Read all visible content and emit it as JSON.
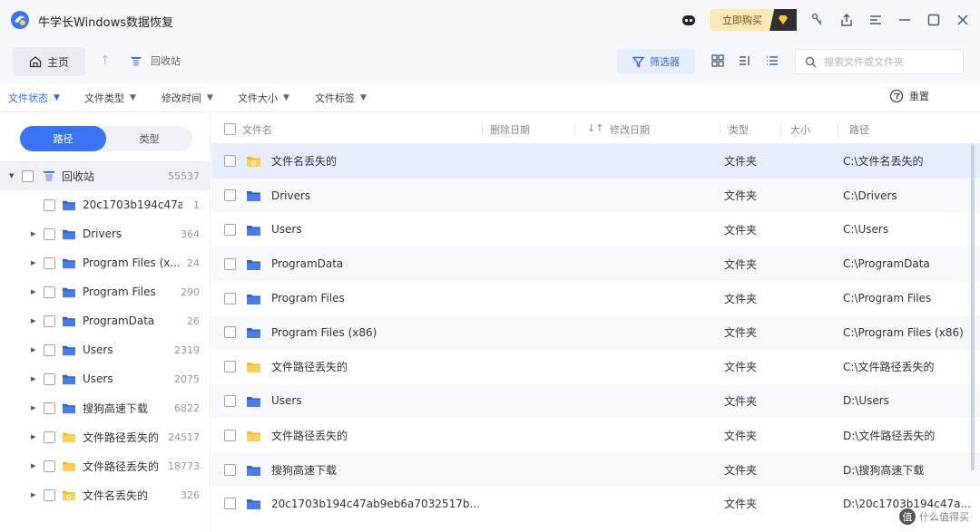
{
  "app": {
    "title": "牛学长Windows数据恢复",
    "buy_label": "立即购买",
    "colors": {
      "accent": "#3b74f2",
      "folder_blue": "#3f6fd8",
      "folder_yellow": "#f5b92b",
      "buy_bg": "#fde9b8"
    }
  },
  "toolbar": {
    "home_label": "主页",
    "crumb_label": "回收站",
    "filter_label": "筛选器",
    "search_placeholder": "搜索文件或文件夹"
  },
  "filters": {
    "file_status": "文件状态",
    "file_type": "文件类型",
    "modified_time": "修改时间",
    "file_size": "文件大小",
    "file_tag": "文件标签",
    "reset": "重置"
  },
  "sidebar": {
    "seg_path": "路径",
    "seg_type": "类型",
    "root": {
      "label": "回收站",
      "count": "55537"
    },
    "items": [
      {
        "label": "20c1703b194c47a...",
        "count": "1",
        "color": "blue",
        "expandable": false
      },
      {
        "label": "Drivers",
        "count": "364",
        "color": "blue",
        "expandable": true
      },
      {
        "label": "Program Files (x...",
        "count": "24",
        "color": "blue",
        "expandable": true
      },
      {
        "label": "Program Files",
        "count": "290",
        "color": "blue",
        "expandable": true
      },
      {
        "label": "ProgramData",
        "count": "26",
        "color": "blue",
        "expandable": true
      },
      {
        "label": "Users",
        "count": "2319",
        "color": "blue",
        "expandable": true
      },
      {
        "label": "Users",
        "count": "2075",
        "color": "blue",
        "expandable": true
      },
      {
        "label": "搜狗高速下载",
        "count": "6822",
        "color": "blue",
        "expandable": true
      },
      {
        "label": "文件路径丢失的",
        "count": "24517",
        "color": "yellow",
        "expandable": true
      },
      {
        "label": "文件路径丢失的",
        "count": "18773",
        "color": "yellow",
        "expandable": true
      },
      {
        "label": "文件名丢失的",
        "count": "326",
        "color": "yellow-badge",
        "expandable": true
      }
    ]
  },
  "table": {
    "headers": {
      "name": "文件名",
      "deleted": "删除日期",
      "modified": "修改日期",
      "type": "类型",
      "size": "大小",
      "path": "路径"
    },
    "rows": [
      {
        "name": "文件名丢失的",
        "type": "文件夹",
        "path": "C:\\文件名丢失的",
        "color": "yellow-badge"
      },
      {
        "name": "Drivers",
        "type": "文件夹",
        "path": "C:\\Drivers",
        "color": "blue"
      },
      {
        "name": "Users",
        "type": "文件夹",
        "path": "C:\\Users",
        "color": "blue"
      },
      {
        "name": "ProgramData",
        "type": "文件夹",
        "path": "C:\\ProgramData",
        "color": "blue"
      },
      {
        "name": "Program Files",
        "type": "文件夹",
        "path": "C:\\Program Files",
        "color": "blue"
      },
      {
        "name": "Program Files (x86)",
        "type": "文件夹",
        "path": "C:\\Program Files (x86)",
        "color": "blue"
      },
      {
        "name": "文件路径丢失的",
        "type": "文件夹",
        "path": "C:\\文件路径丢失的",
        "color": "yellow"
      },
      {
        "name": "Users",
        "type": "文件夹",
        "path": "D:\\Users",
        "color": "blue"
      },
      {
        "name": "文件路径丢失的",
        "type": "文件夹",
        "path": "D:\\文件路径丢失的",
        "color": "yellow"
      },
      {
        "name": "搜狗高速下载",
        "type": "文件夹",
        "path": "D:\\搜狗高速下载",
        "color": "blue"
      },
      {
        "name": "20c1703b194c47ab9eb6a7032517b...",
        "type": "文件夹",
        "path": "D:\\20c1703b194c47a...",
        "color": "blue"
      }
    ]
  },
  "watermark": {
    "badge": "值",
    "text": "什么值得买"
  }
}
